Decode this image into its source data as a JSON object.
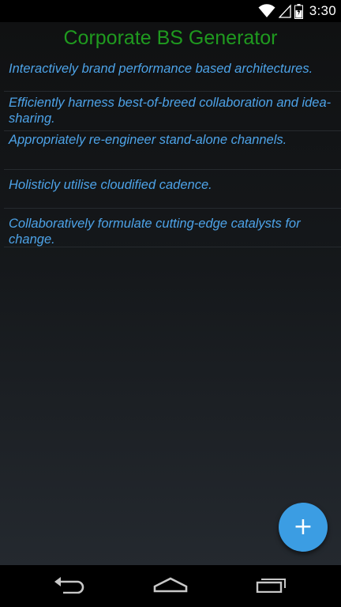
{
  "status_bar": {
    "time": "3:30",
    "icons": [
      "wifi-icon",
      "signal-icon",
      "battery-icon"
    ]
  },
  "app": {
    "title": "Corporate BS Generator",
    "title_color": "#1f9a1f",
    "items": [
      "Interactively brand performance based architectures.",
      "Efficiently harness best-of-breed collaboration and idea-sharing.",
      "Appropriately re-engineer stand-alone channels.",
      "Holisticly utilise cloudified cadence.",
      "Collaboratively formulate cutting-edge catalysts for change."
    ],
    "item_color": "#4da3e8",
    "fab": {
      "label": "+",
      "icon": "plus-icon",
      "color": "#3b9de3"
    }
  },
  "nav_bar": {
    "buttons": [
      "back-icon",
      "home-icon",
      "recents-icon"
    ]
  }
}
